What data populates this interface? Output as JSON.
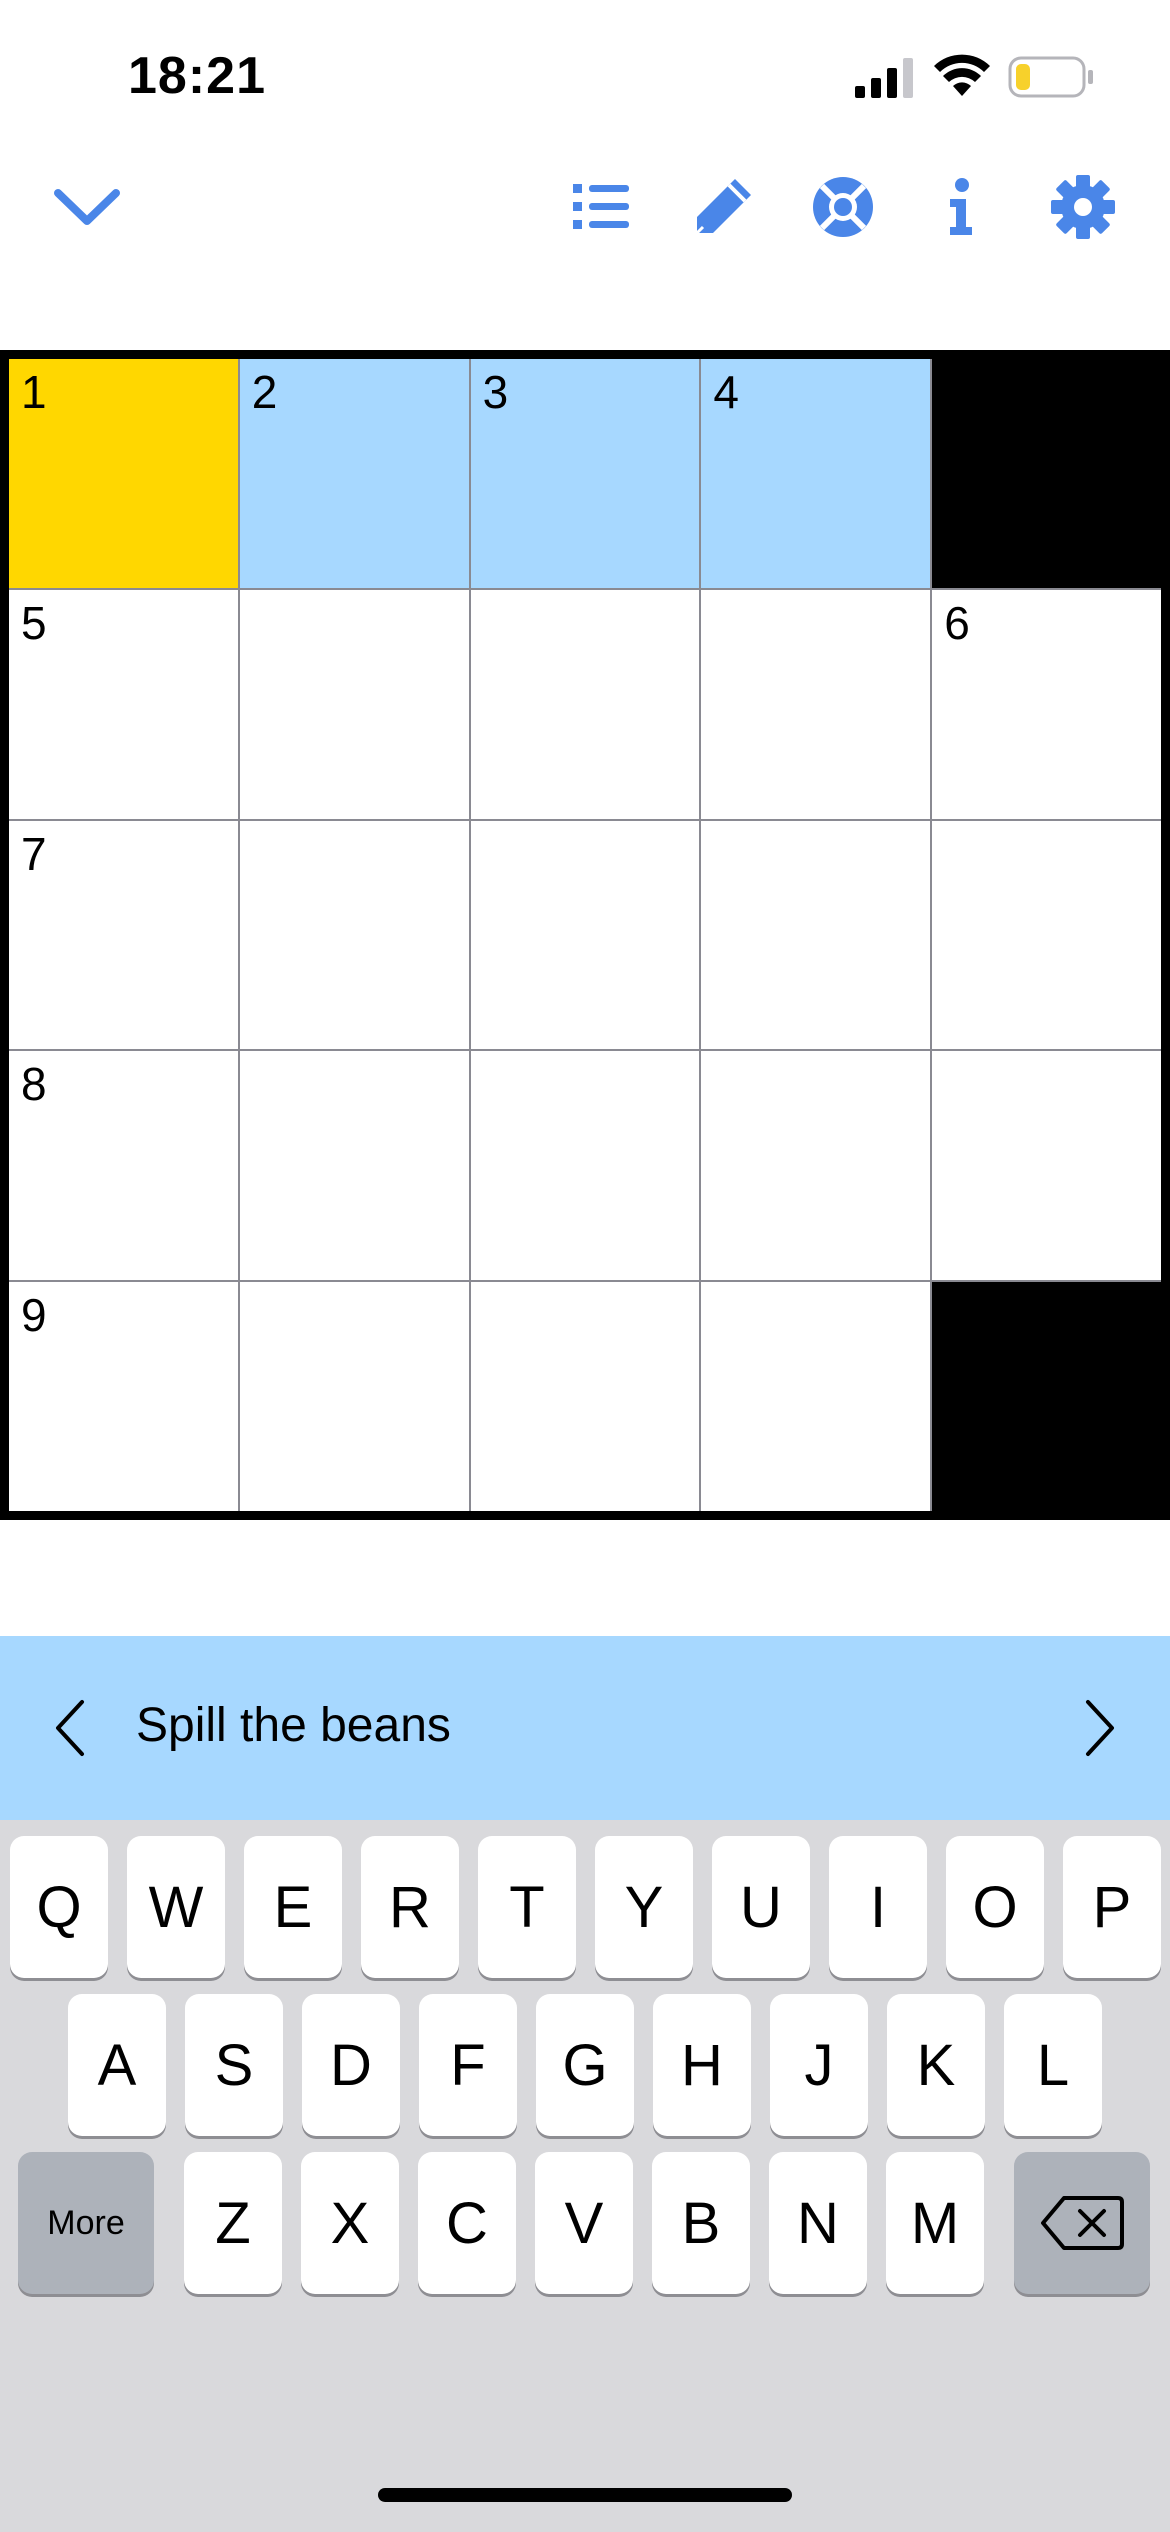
{
  "status_bar": {
    "time": "18:21",
    "icons": [
      "signal-icon",
      "wifi-icon",
      "battery-icon"
    ],
    "battery_color": "#f7d12b"
  },
  "toolbar": {
    "icons": [
      "chevron-down-icon",
      "clue-list-icon",
      "pencil-icon",
      "help-lifebuoy-icon",
      "info-icon",
      "settings-gear-icon"
    ],
    "icon_color": "#4a86e8"
  },
  "grid": {
    "size": 5,
    "colors": {
      "focus": "#ffd700",
      "word": "#a7d8ff",
      "block": "#000000",
      "empty": "#ffffff"
    },
    "cells": [
      [
        {
          "num": "1",
          "state": "focus"
        },
        {
          "num": "2",
          "state": "word"
        },
        {
          "num": "3",
          "state": "word"
        },
        {
          "num": "4",
          "state": "word"
        },
        {
          "block": true
        }
      ],
      [
        {
          "num": "5"
        },
        {
          "num": ""
        },
        {
          "num": ""
        },
        {
          "num": ""
        },
        {
          "num": "6"
        }
      ],
      [
        {
          "num": "7"
        },
        {
          "num": ""
        },
        {
          "num": ""
        },
        {
          "num": ""
        },
        {
          "num": ""
        }
      ],
      [
        {
          "num": "8"
        },
        {
          "num": ""
        },
        {
          "num": ""
        },
        {
          "num": ""
        },
        {
          "num": ""
        }
      ],
      [
        {
          "num": "9"
        },
        {
          "num": ""
        },
        {
          "num": ""
        },
        {
          "num": ""
        },
        {
          "block": true
        }
      ]
    ]
  },
  "clue": {
    "text": "Spill the beans",
    "prev_icon": "chevron-left-icon",
    "next_icon": "chevron-right-icon"
  },
  "keyboard": {
    "row1": [
      "Q",
      "W",
      "E",
      "R",
      "T",
      "Y",
      "U",
      "I",
      "O",
      "P"
    ],
    "row2": [
      "A",
      "S",
      "D",
      "F",
      "G",
      "H",
      "J",
      "K",
      "L"
    ],
    "row3": [
      "Z",
      "X",
      "C",
      "V",
      "B",
      "N",
      "M"
    ],
    "more_label": "More",
    "backspace_icon": "backspace-icon"
  }
}
